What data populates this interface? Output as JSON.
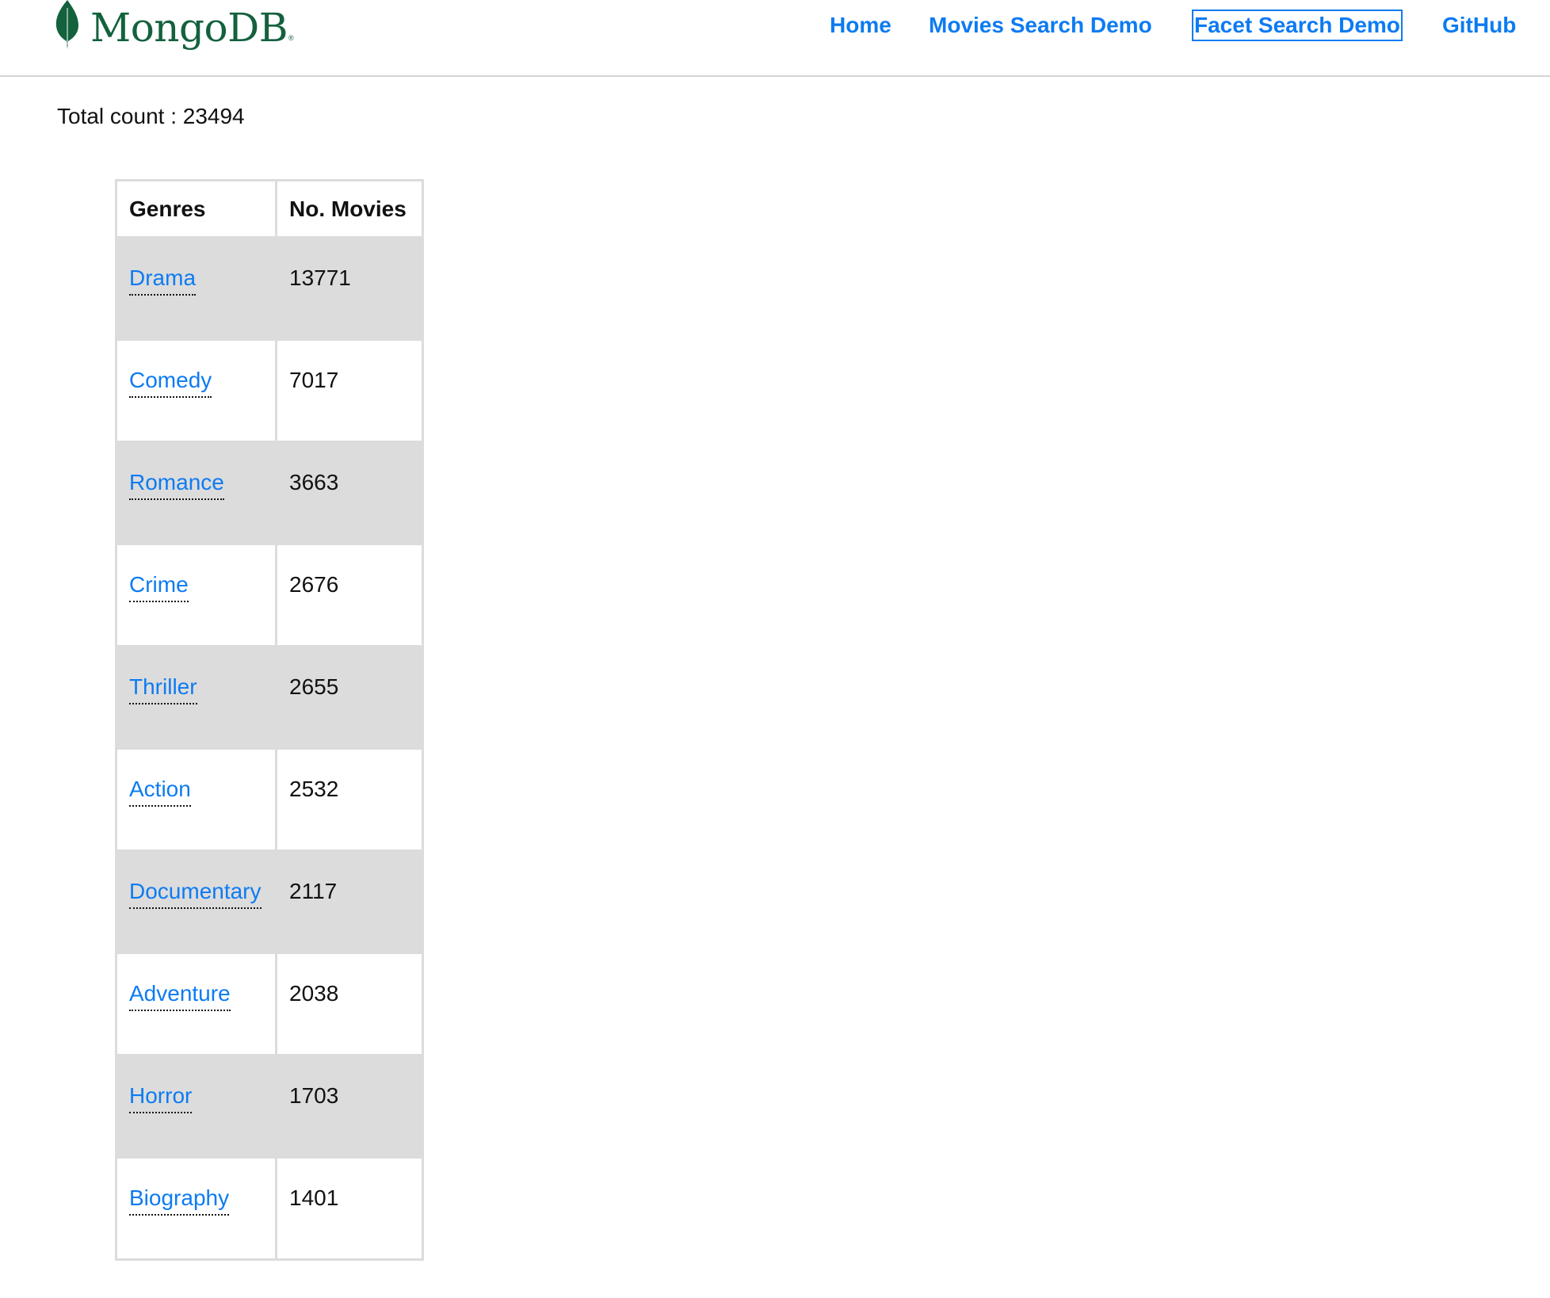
{
  "header": {
    "logo_text": "MongoDB",
    "logo_registered": "®",
    "logo_icon": "mongodb-leaf-icon",
    "brand_color": "#13613d",
    "nav": [
      {
        "label": "Home",
        "active": false
      },
      {
        "label": "Movies Search Demo",
        "active": false
      },
      {
        "label": "Facet Search Demo",
        "active": true
      },
      {
        "label": "GitHub",
        "active": false
      }
    ],
    "link_color": "#0d7bf2"
  },
  "main": {
    "total_count_label": "Total count : 23494",
    "total_count": 23494,
    "table": {
      "columns": [
        "Genres",
        "No. Movies"
      ],
      "rows": [
        {
          "genre": "Drama",
          "count": "13771"
        },
        {
          "genre": "Comedy",
          "count": "7017"
        },
        {
          "genre": "Romance",
          "count": "3663"
        },
        {
          "genre": "Crime",
          "count": "2676"
        },
        {
          "genre": "Thriller",
          "count": "2655"
        },
        {
          "genre": "Action",
          "count": "2532"
        },
        {
          "genre": "Documentary",
          "count": "2117"
        },
        {
          "genre": "Adventure",
          "count": "2038"
        },
        {
          "genre": "Horror",
          "count": "1703"
        },
        {
          "genre": "Biography",
          "count": "1401"
        }
      ],
      "stripe_color": "#dcdcdc"
    }
  }
}
